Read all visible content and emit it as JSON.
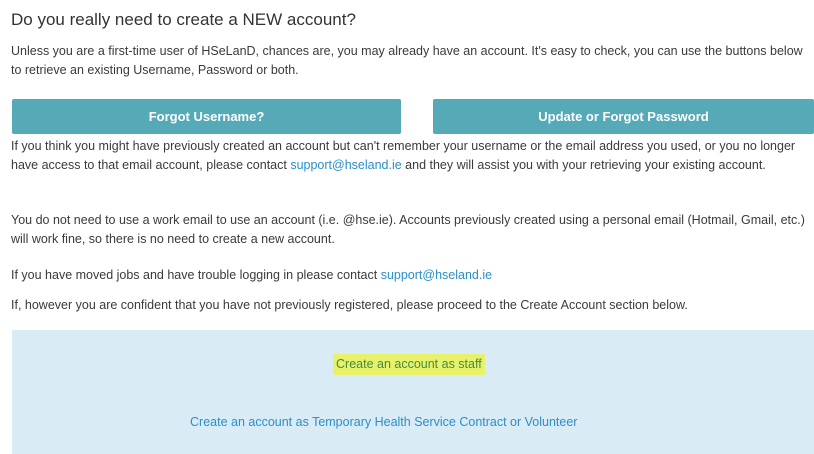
{
  "heading": "Do you really need to create a NEW account?",
  "intro": {
    "text": "Unless you are a first-time user of HSeLanD, chances are, you may already have an account. It's easy to check, you can use the buttons below to retrieve an existing Username, Password or both."
  },
  "buttons": {
    "forgot_username": "Forgot Username?",
    "forgot_password": "Update or Forgot Password"
  },
  "retrieve": {
    "before": "If you think you might have previously created an account but can't remember your username or the email address you used, or you no longer have access to that email account, please contact ",
    "email": "support@hseland.ie",
    "after": " and they will assist you with your retrieving your existing account."
  },
  "work_email": {
    "text": "You do not need to use a work email to use an account (i.e. @hse.ie). Accounts previously created using a personal email (Hotmail, Gmail, etc.) will work fine, so there is no need to create a new account."
  },
  "moved_jobs": {
    "before": "If you have moved jobs and have trouble logging in please contact ",
    "email": "support@hseland.ie"
  },
  "proceed": {
    "text": "If, however you are confident that you have not previously registered, please proceed to the Create Account section below."
  },
  "create": {
    "staff_link": "Create an account as staff",
    "temp_link": "Create an account as Temporary Health Service Contract or Volunteer"
  },
  "colors": {
    "button_bg": "#56a9b7",
    "link": "#2b8fc9",
    "panel_bg": "#d9ebf5",
    "highlight": "#e7f26a"
  }
}
